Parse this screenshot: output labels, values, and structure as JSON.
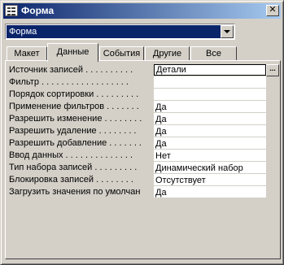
{
  "window": {
    "title": "Форма",
    "close_glyph": "✕"
  },
  "selector": {
    "value": "Форма"
  },
  "tabs": [
    {
      "label": "Макет"
    },
    {
      "label": "Данные",
      "active": true
    },
    {
      "label": "События"
    },
    {
      "label": "Другие"
    },
    {
      "label": "Все"
    }
  ],
  "properties": [
    {
      "label": "Источник записей . . . . . . . . . .",
      "value": "Детали"
    },
    {
      "label": "Фильтр . . . . . . . . . . . . . . . . . .",
      "value": ""
    },
    {
      "label": "Порядок сортировки . . . . . . . . .",
      "value": ""
    },
    {
      "label": "Применение фильтров . . . . . . .",
      "value": "Да"
    },
    {
      "label": "Разрешить изменение . . . . . . . .",
      "value": "Да"
    },
    {
      "label": "Разрешить удаление . . . . . . . .",
      "value": "Да"
    },
    {
      "label": "Разрешить добавление . . . . . . .",
      "value": "Да"
    },
    {
      "label": "Ввод данных . . . . . . . . . . . . . .",
      "value": "Нет"
    },
    {
      "label": "Тип набора записей . . . . . . . . .",
      "value": "Динамический набор"
    },
    {
      "label": "Блокировка записей . . . . . . . .",
      "value": "Отсутствует"
    },
    {
      "label": "Загрузить значения по умолчан",
      "value": "Да"
    }
  ],
  "build_button_glyph": "..."
}
